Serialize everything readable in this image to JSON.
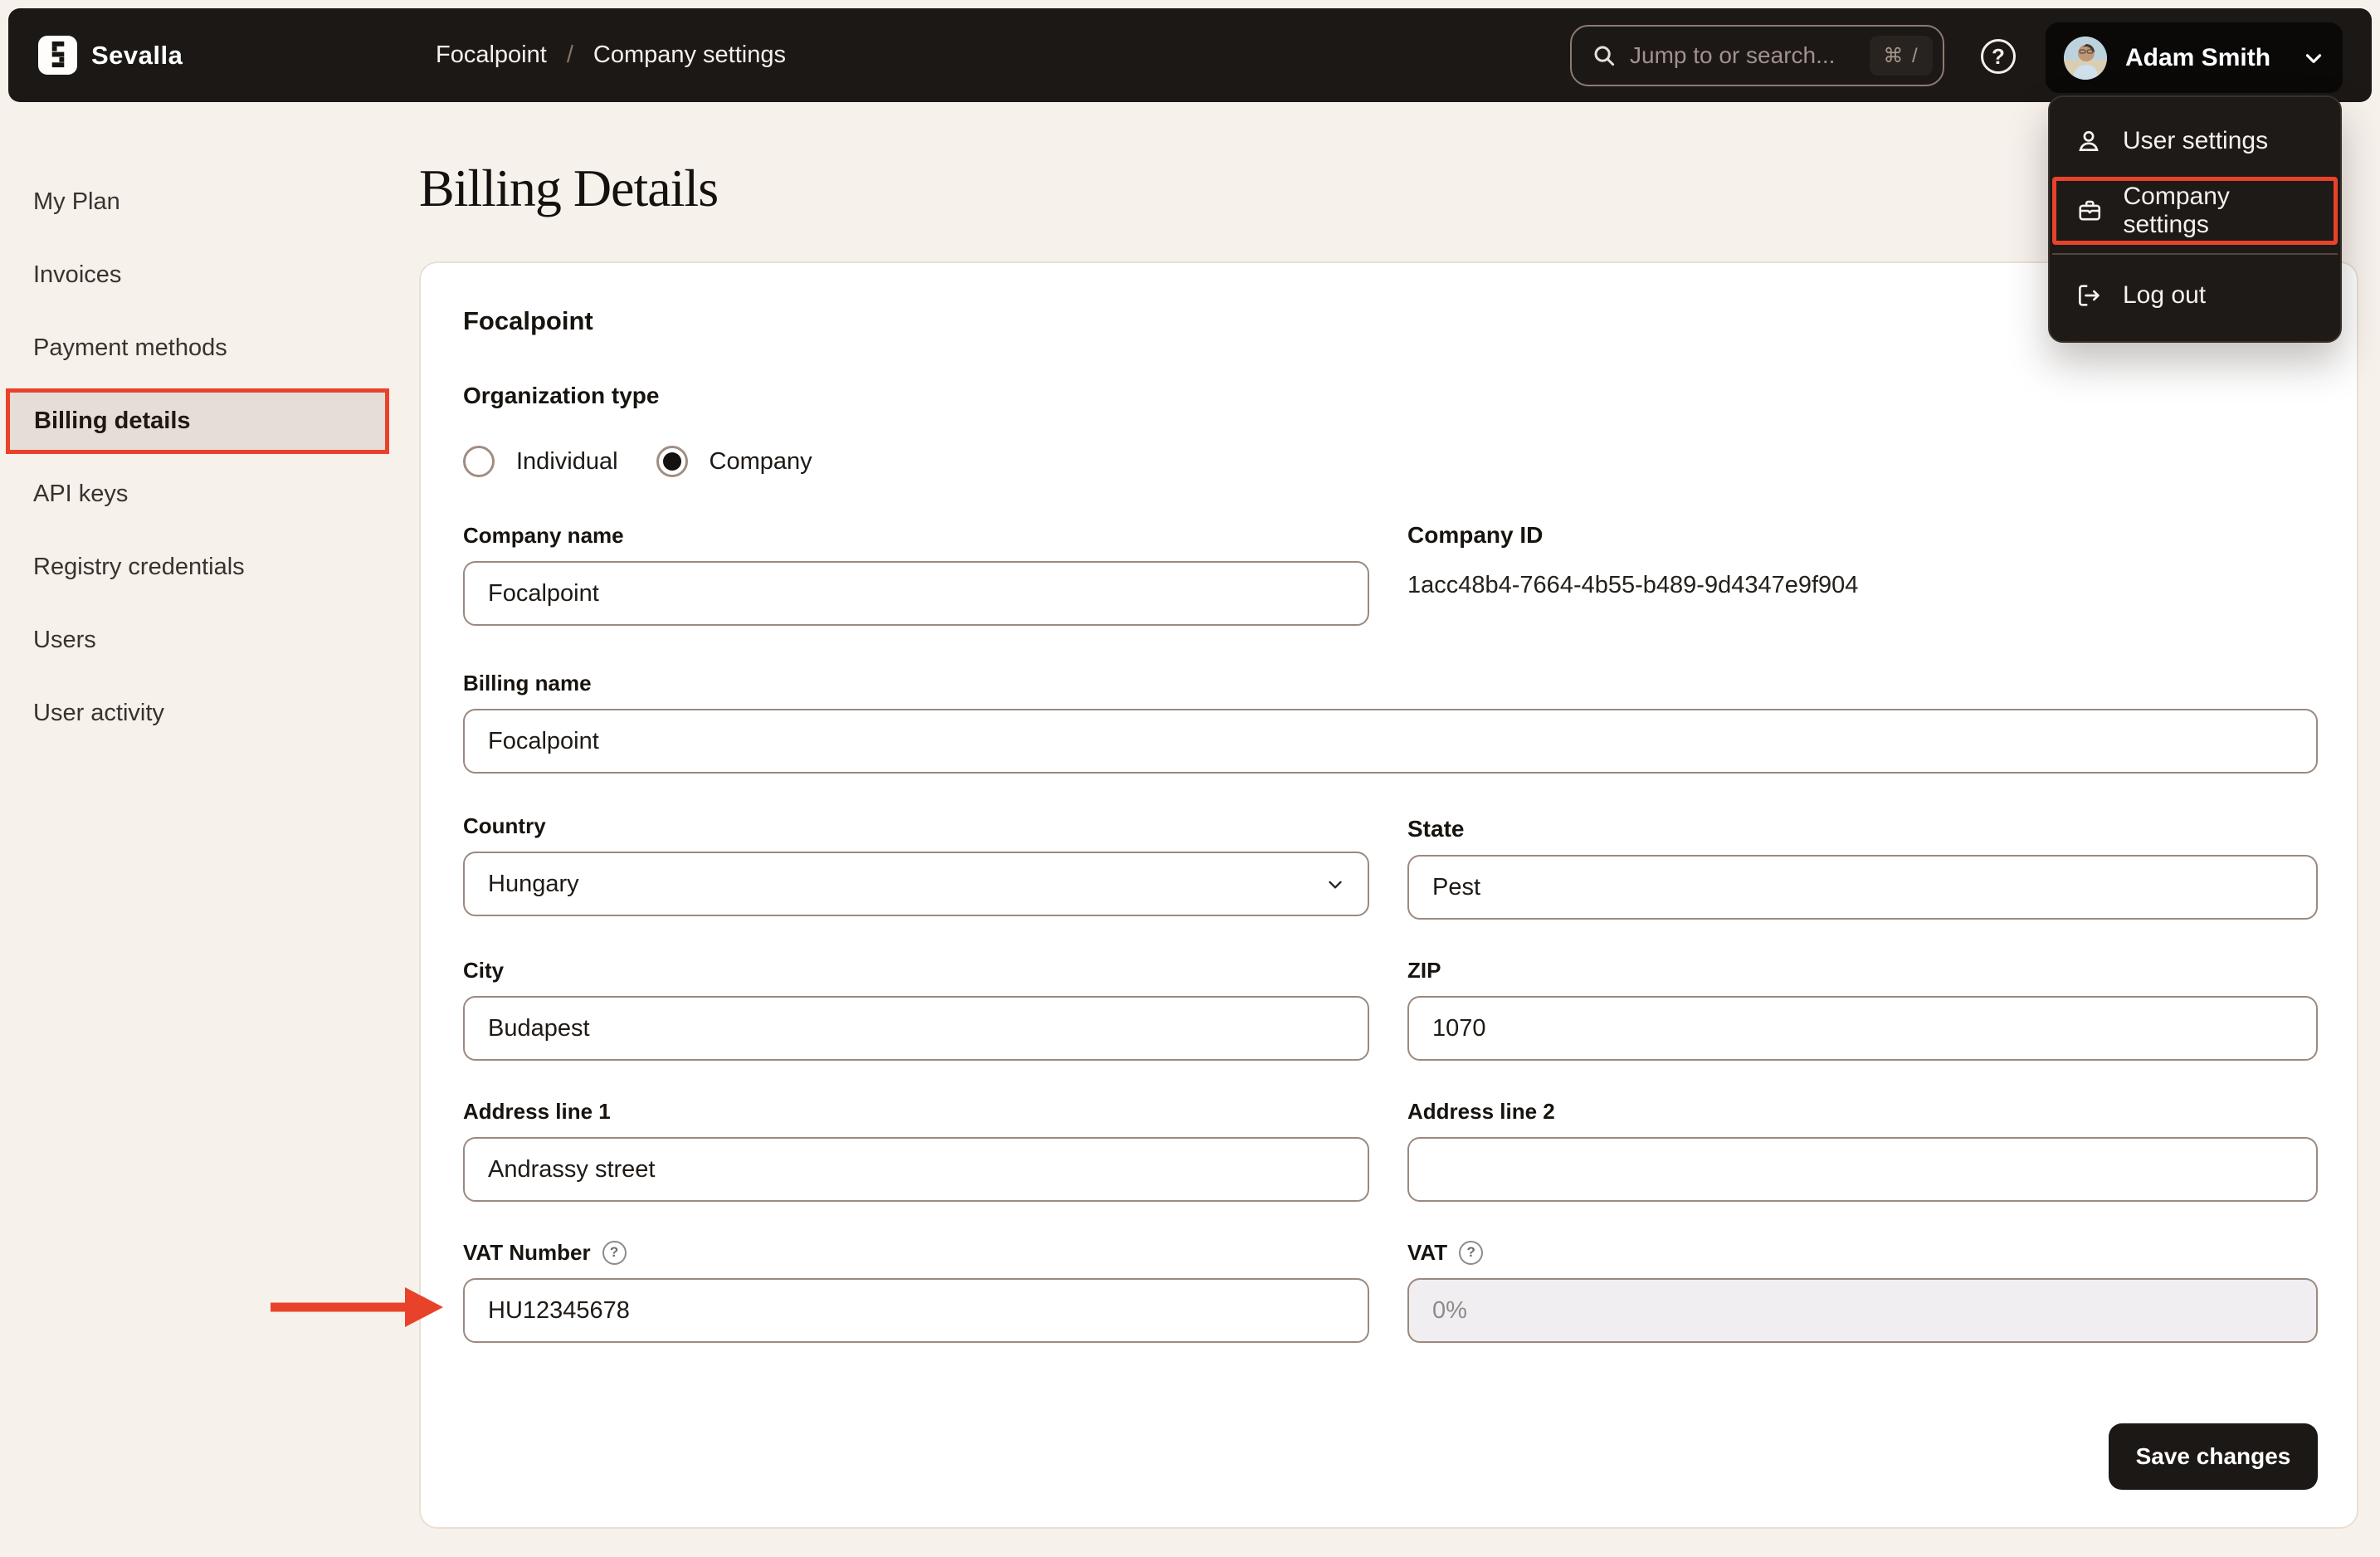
{
  "topbar": {
    "brand": "Sevalla",
    "breadcrumb": {
      "org": "Focalpoint",
      "separator": "/",
      "page": "Company settings"
    },
    "search": {
      "placeholder": "Jump to or search...",
      "shortcut": "⌘ /"
    },
    "help_glyph": "?",
    "user": {
      "name": "Adam Smith"
    }
  },
  "user_menu": {
    "items": [
      {
        "label": "User settings",
        "icon": "user-icon"
      },
      {
        "label": "Company settings",
        "icon": "briefcase-icon",
        "highlighted": true
      },
      {
        "label": "Log out",
        "icon": "logout-icon"
      }
    ]
  },
  "sidebar": {
    "items": [
      {
        "label": "My Plan"
      },
      {
        "label": "Invoices"
      },
      {
        "label": "Payment methods"
      },
      {
        "label": "Billing details",
        "active": true
      },
      {
        "label": "API keys"
      },
      {
        "label": "Registry credentials"
      },
      {
        "label": "Users"
      },
      {
        "label": "User activity"
      }
    ]
  },
  "page": {
    "title": "Billing Details"
  },
  "form": {
    "card_title": "Focalpoint",
    "organization_type": {
      "label": "Organization type",
      "options": [
        {
          "label": "Individual",
          "selected": false
        },
        {
          "label": "Company",
          "selected": true
        }
      ]
    },
    "fields": {
      "company_name": {
        "label": "Company name",
        "value": "Focalpoint"
      },
      "company_id": {
        "label": "Company ID",
        "value": "1acc48b4-7664-4b55-b489-9d4347e9f904"
      },
      "billing_name": {
        "label": "Billing name",
        "value": "Focalpoint"
      },
      "country": {
        "label": "Country",
        "value": "Hungary"
      },
      "state": {
        "label": "State",
        "value": "Pest"
      },
      "city": {
        "label": "City",
        "value": "Budapest"
      },
      "zip": {
        "label": "ZIP",
        "value": "1070"
      },
      "address1": {
        "label": "Address line 1",
        "value": "Andrassy street"
      },
      "address2": {
        "label": "Address line 2",
        "value": ""
      },
      "vat_number": {
        "label": "VAT Number",
        "value": "HU12345678",
        "help_glyph": "?"
      },
      "vat": {
        "label": "VAT",
        "value": "0%",
        "disabled": true,
        "help_glyph": "?"
      }
    },
    "save_label": "Save changes"
  },
  "colors": {
    "accent_red": "#e8432a",
    "topbar_bg": "#1b1816",
    "page_bg": "#f7f1ec",
    "sidebar_active_bg": "#e6ddd6",
    "input_border": "#9b897f",
    "disabled_bg": "#f0eef0"
  }
}
